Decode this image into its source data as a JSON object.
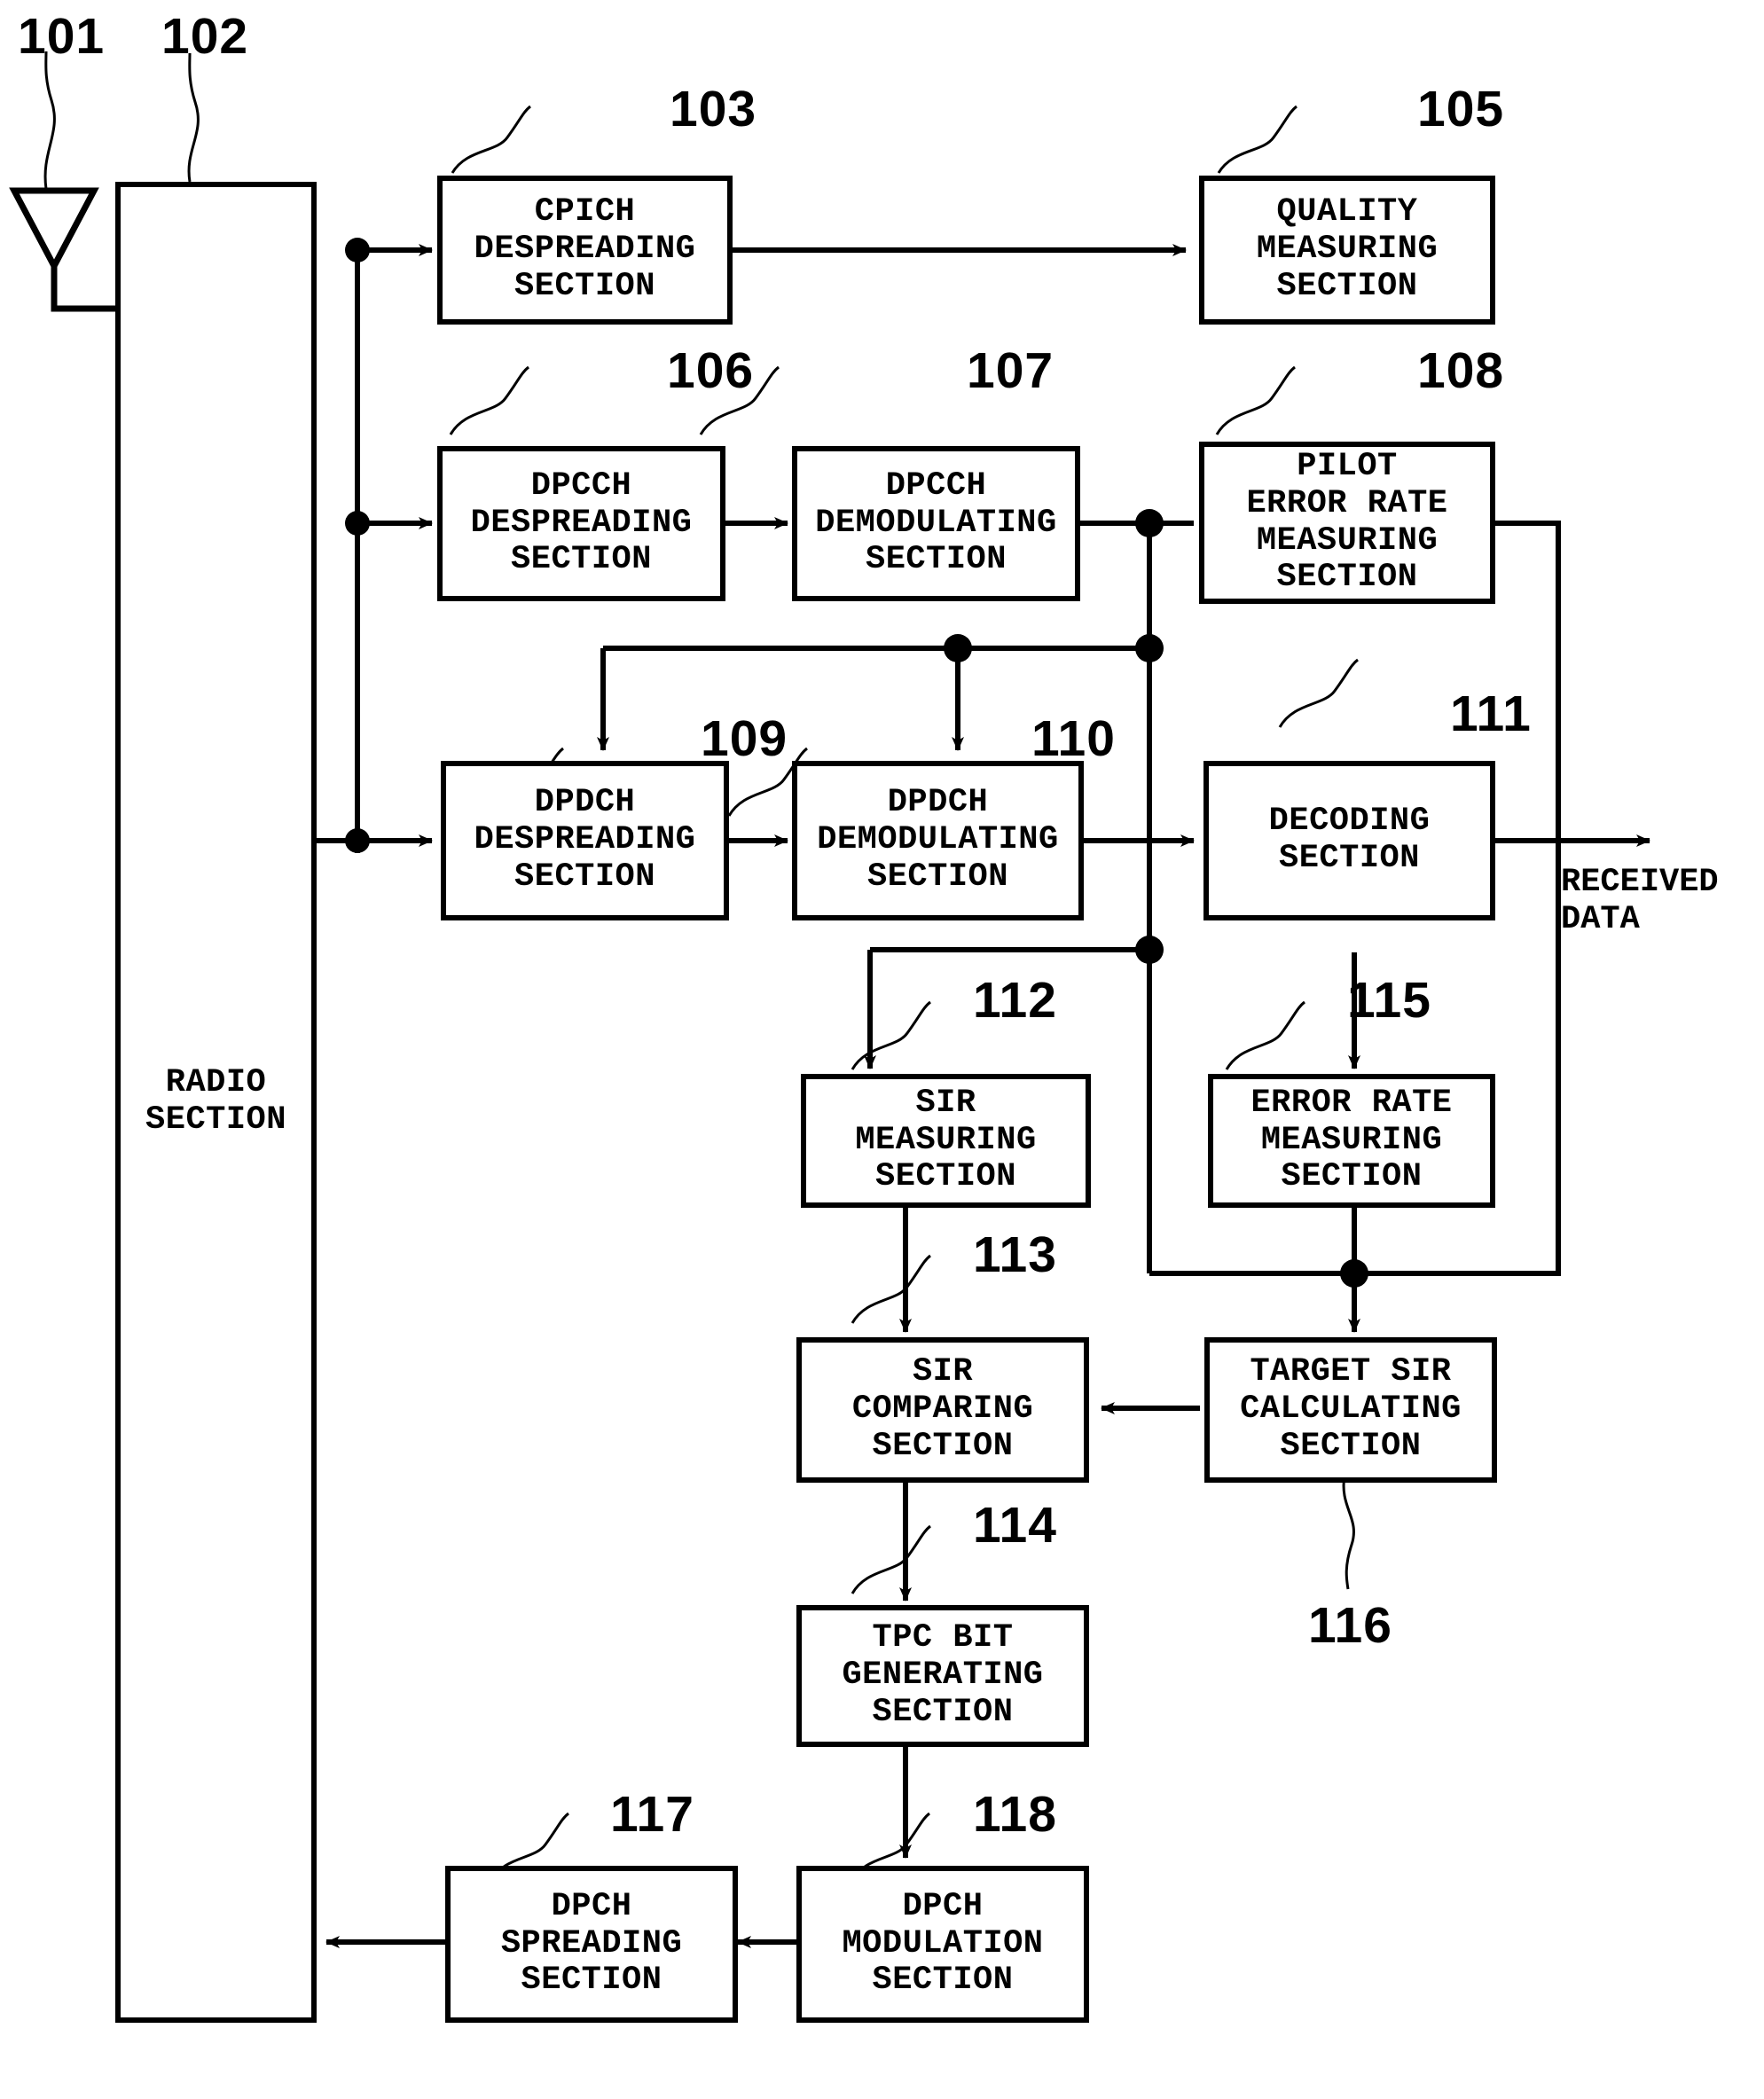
{
  "figure": {
    "kind": "patent-block-diagram",
    "ink_color": "#000000",
    "background_color": "#ffffff"
  },
  "nodes": [
    {
      "id": "antenna",
      "ref": "101",
      "label": ""
    },
    {
      "id": "radio",
      "ref": "102",
      "label": "RADIO\nSECTION"
    },
    {
      "id": "cpich_despreading",
      "ref": "103",
      "label": "CPICH\nDESPREADING\nSECTION"
    },
    {
      "id": "quality_measuring",
      "ref": "105",
      "label": "QUALITY\nMEASURING\nSECTION"
    },
    {
      "id": "dpcch_despreading",
      "ref": "106",
      "label": "DPCCH\nDESPREADING\nSECTION"
    },
    {
      "id": "dpcch_demodulating",
      "ref": "107",
      "label": "DPCCH\nDEMODULATING\nSECTION"
    },
    {
      "id": "pilot_error_rate",
      "ref": "108",
      "label": "PILOT\nERROR RATE\nMEASURING\nSECTION"
    },
    {
      "id": "dpdch_despreading",
      "ref": "109",
      "label": "DPDCH\nDESPREADING\nSECTION"
    },
    {
      "id": "dpdch_demodulating",
      "ref": "110",
      "label": "DPDCH\nDEMODULATING\nSECTION"
    },
    {
      "id": "decoding",
      "ref": "111",
      "label": "DECODING\nSECTION"
    },
    {
      "id": "sir_measuring",
      "ref": "112",
      "label": "SIR\nMEASURING\nSECTION"
    },
    {
      "id": "sir_comparing",
      "ref": "113",
      "label": "SIR\nCOMPARING\nSECTION"
    },
    {
      "id": "tpc_bit_generating",
      "ref": "114",
      "label": "TPC BIT\nGENERATING\nSECTION"
    },
    {
      "id": "error_rate_measuring",
      "ref": "115",
      "label": "ERROR RATE\nMEASURING\nSECTION"
    },
    {
      "id": "target_sir_calculating",
      "ref": "116",
      "label": "TARGET SIR\nCALCULATING\nSECTION"
    },
    {
      "id": "dpch_spreading",
      "ref": "117",
      "label": "DPCH\nSPREADING\nSECTION"
    },
    {
      "id": "dpch_modulation",
      "ref": "118",
      "label": "DPCH\nMODULATION\nSECTION"
    }
  ],
  "reference_numerals": {
    "n101": "101",
    "n102": "102",
    "n103": "103",
    "n105": "105",
    "n106": "106",
    "n107": "107",
    "n108": "108",
    "n109": "109",
    "n110": "110",
    "n111": "111",
    "n112": "112",
    "n113": "113",
    "n114": "114",
    "n115": "115",
    "n116": "116",
    "n117": "117",
    "n118": "118"
  },
  "annotations": {
    "received_data": "RECEIVED\nDATA"
  },
  "node_labels": {
    "antenna": "",
    "radio": "RADIO\nSECTION",
    "cpich_despreading": "CPICH\nDESPREADING\nSECTION",
    "quality_measuring": "QUALITY\nMEASURING\nSECTION",
    "dpcch_despreading": "DPCCH\nDESPREADING\nSECTION",
    "dpcch_demodulating": "DPCCH\nDEMODULATING\nSECTION",
    "pilot_error_rate": "PILOT\nERROR RATE\nMEASURING\nSECTION",
    "dpdch_despreading": "DPDCH\nDESPREADING\nSECTION",
    "dpdch_demodulating": "DPDCH\nDEMODULATING\nSECTION",
    "decoding": "DECODING\nSECTION",
    "sir_measuring": "SIR\nMEASURING\nSECTION",
    "sir_comparing": "SIR\nCOMPARING\nSECTION",
    "tpc_bit_generating": "TPC BIT\nGENERATING\nSECTION",
    "error_rate_measuring": "ERROR RATE\nMEASURING\nSECTION",
    "target_sir_calculating": "TARGET SIR\nCALCULATING\nSECTION",
    "dpch_spreading": "DPCH\nSPREADING\nSECTION",
    "dpch_modulation": "DPCH\nMODULATION\nSECTION"
  },
  "connections": [
    {
      "from": "antenna",
      "to": "radio"
    },
    {
      "from": "radio",
      "to": "cpich_despreading"
    },
    {
      "from": "radio",
      "to": "dpcch_despreading"
    },
    {
      "from": "radio",
      "to": "dpdch_despreading"
    },
    {
      "from": "cpich_despreading",
      "to": "quality_measuring"
    },
    {
      "from": "dpcch_despreading",
      "to": "dpcch_demodulating"
    },
    {
      "from": "dpcch_demodulating",
      "to": "pilot_error_rate"
    },
    {
      "from": "dpcch_demodulating",
      "to": "dpdch_despreading"
    },
    {
      "from": "dpcch_demodulating",
      "to": "dpdch_demodulating"
    },
    {
      "from": "dpcch_demodulating",
      "to": "sir_measuring"
    },
    {
      "from": "dpdch_despreading",
      "to": "dpdch_demodulating"
    },
    {
      "from": "dpdch_demodulating",
      "to": "decoding"
    },
    {
      "from": "decoding",
      "to": "received_data"
    },
    {
      "from": "decoding",
      "to": "error_rate_measuring"
    },
    {
      "from": "pilot_error_rate",
      "to": "target_sir_calculating"
    },
    {
      "from": "error_rate_measuring",
      "to": "target_sir_calculating"
    },
    {
      "from": "sir_measuring",
      "to": "sir_comparing"
    },
    {
      "from": "target_sir_calculating",
      "to": "sir_comparing"
    },
    {
      "from": "sir_comparing",
      "to": "tpc_bit_generating"
    },
    {
      "from": "tpc_bit_generating",
      "to": "dpch_modulation"
    },
    {
      "from": "dpch_modulation",
      "to": "dpch_spreading"
    },
    {
      "from": "dpch_spreading",
      "to": "radio"
    }
  ]
}
